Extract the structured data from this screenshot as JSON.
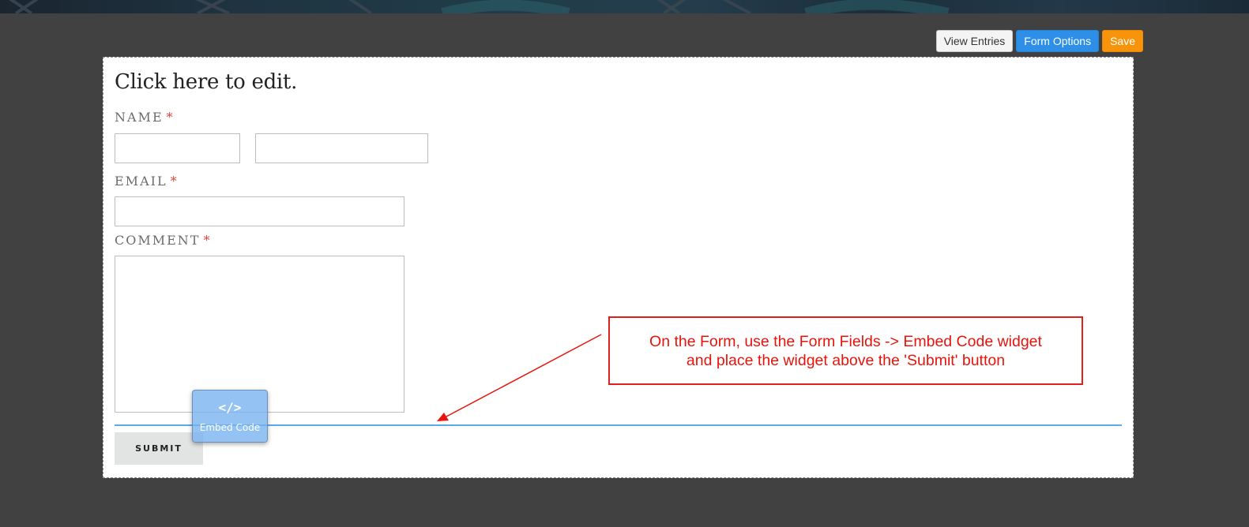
{
  "toolbar": {
    "view_entries": "View Entries",
    "form_options": "Form Options",
    "save": "Save"
  },
  "form": {
    "title": "Click here to edit.",
    "fields": {
      "name": {
        "label": "NAME",
        "required": "*"
      },
      "email": {
        "label": "EMAIL",
        "required": "*"
      },
      "comment": {
        "label": "COMMENT",
        "required": "*"
      }
    },
    "submit_label": "SUBMIT"
  },
  "embed_widget": {
    "icon": "code-icon",
    "glyph": "</>",
    "label": "Embed Code"
  },
  "annotation": {
    "line1": "On the Form, use the Form Fields -> Embed Code widget",
    "line2": "and place the widget above the 'Submit' button"
  },
  "colors": {
    "page_background": "#414141",
    "form_options_button": "#2d8fe8",
    "save_button": "#f7940c",
    "required_marker": "#e0443c",
    "drop_indicator": "#5aaaf0",
    "annotation": "#e0201a"
  }
}
